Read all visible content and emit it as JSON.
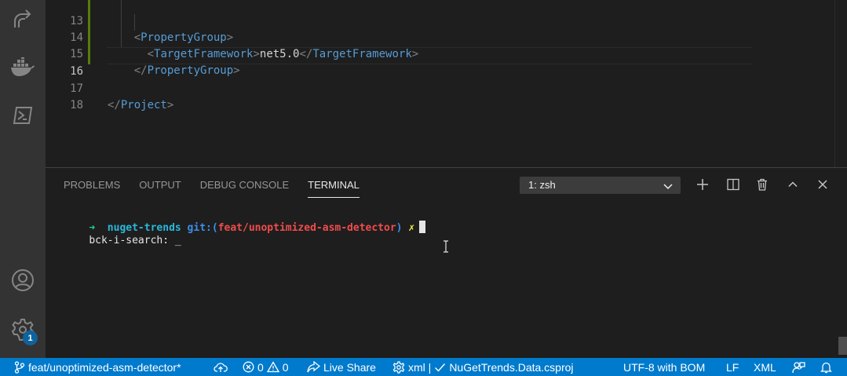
{
  "editor": {
    "lines": [
      {
        "number": "13",
        "indent": "    ",
        "open": "<",
        "tag": "PropertyGroup",
        "close": ">",
        "text": "",
        "end_open": "",
        "end_tag": "",
        "end_close": ""
      },
      {
        "number": "14",
        "indent": "      ",
        "open": "<",
        "tag": "TargetFramework",
        "close": ">",
        "text": "net5.0",
        "end_open": "</",
        "end_tag": "TargetFramework",
        "end_close": ">"
      },
      {
        "number": "15",
        "indent": "    ",
        "open": "</",
        "tag": "PropertyGroup",
        "close": ">",
        "text": "",
        "end_open": "",
        "end_tag": "",
        "end_close": ""
      },
      {
        "number": "16",
        "indent": "",
        "open": "",
        "tag": "",
        "close": "",
        "text": "",
        "end_open": "",
        "end_tag": "",
        "end_close": ""
      },
      {
        "number": "17",
        "indent": "",
        "open": "</",
        "tag": "Project",
        "close": ">",
        "text": "",
        "end_open": "",
        "end_tag": "",
        "end_close": ""
      },
      {
        "number": "18",
        "indent": "",
        "open": "",
        "tag": "",
        "close": "",
        "text": "",
        "end_open": "",
        "end_tag": "",
        "end_close": ""
      }
    ],
    "active_line": "16"
  },
  "panel": {
    "tabs": [
      "PROBLEMS",
      "OUTPUT",
      "DEBUG CONSOLE",
      "TERMINAL"
    ],
    "active_tab": "TERMINAL",
    "terminal_select": "1: zsh",
    "actions": [
      "plus-icon",
      "split-icon",
      "trash-icon",
      "chevron-up-icon",
      "close-icon"
    ]
  },
  "terminal": {
    "prompt_arrow": "➜",
    "directory": "nuget-trends",
    "git_label": "git:(",
    "branch": "feat/unoptimized-asm-detector",
    "git_close": ")",
    "dirty_mark": "✗",
    "search_line": "bck-i-search: _"
  },
  "status_bar": {
    "branch": "feat/unoptimized-asm-detector*",
    "errors": "0",
    "warnings": "0",
    "live_share": "Live Share",
    "language_mode_prefix": "xml |",
    "project": "NuGetTrends.Data.csproj",
    "encoding": "UTF-8 with BOM",
    "eol": "LF",
    "language": "XML"
  },
  "activity_bar": {
    "icons": [
      "remote-explorer-icon",
      "docker-icon",
      "powershell-icon",
      "account-icon",
      "settings-gear-icon"
    ],
    "settings_badge": "1"
  },
  "colors": {
    "status_bar": "#007acc",
    "activity_bar": "#333333",
    "editor_bg": "#1e1e1e",
    "xml_tag": "#569cd6",
    "git_modified_gutter": "#587c0c"
  }
}
